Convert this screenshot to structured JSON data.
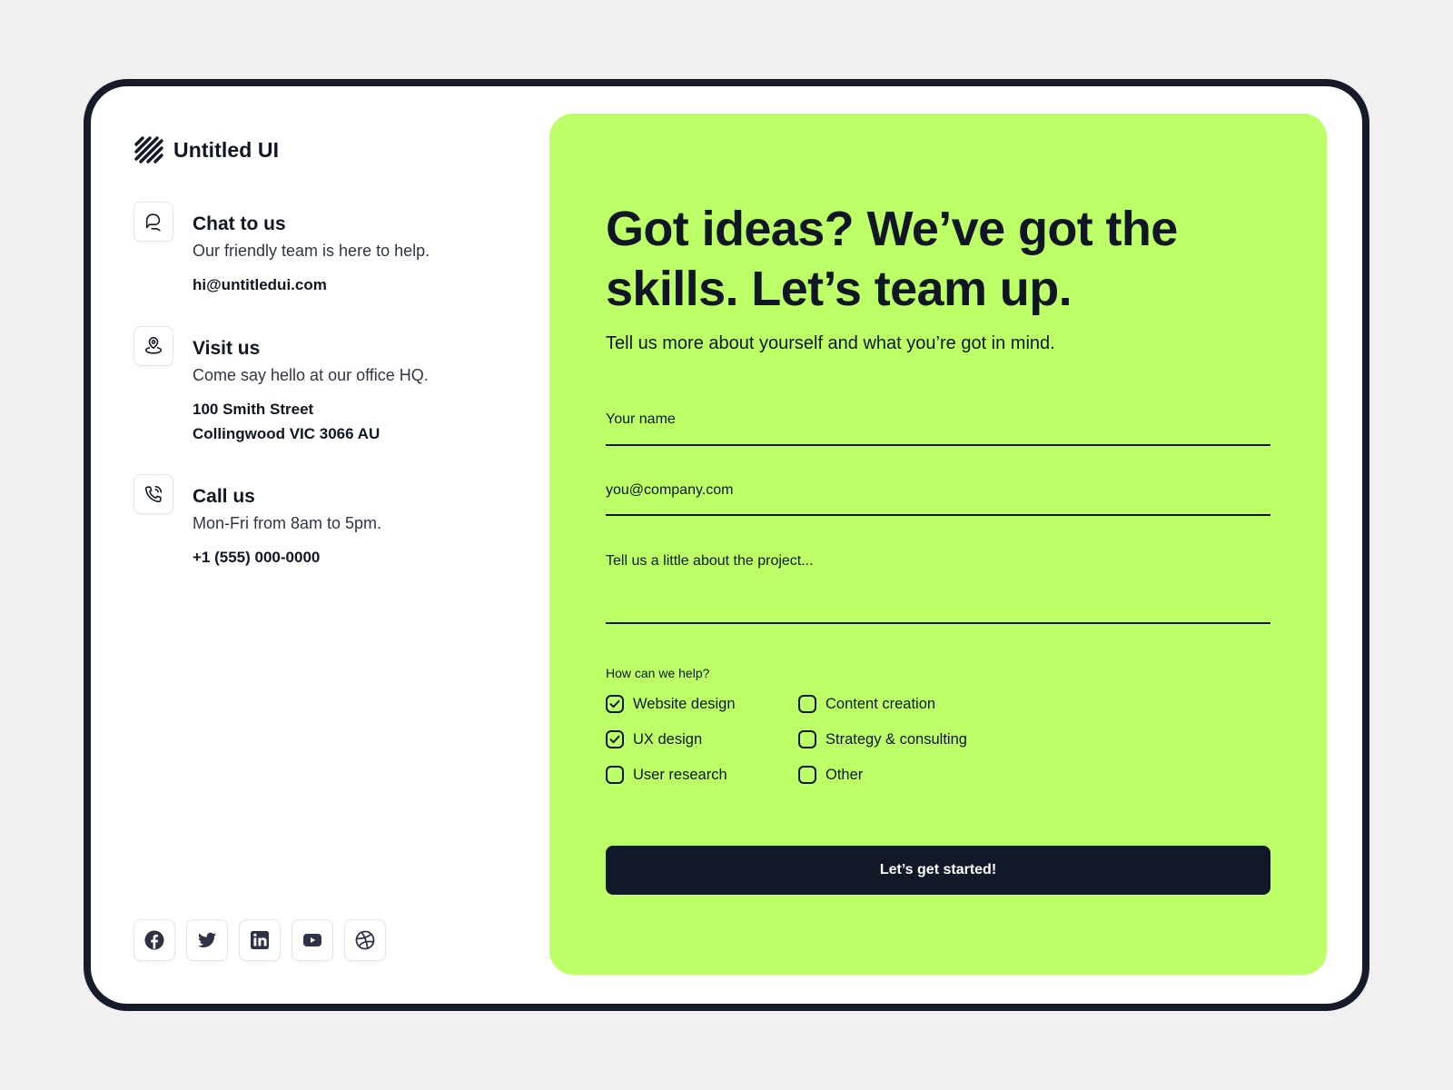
{
  "brand": {
    "name": "Untitled UI",
    "logo_icon": "untitled-ui-logo-icon"
  },
  "contacts": [
    {
      "icon": "chat-bubble-icon",
      "title": "Chat to us",
      "subtitle": "Our friendly team is here to help.",
      "value_lines": [
        "hi@untitledui.com"
      ]
    },
    {
      "icon": "map-pin-icon",
      "title": "Visit us",
      "subtitle": "Come say hello at our office HQ.",
      "value_lines": [
        "100 Smith Street",
        "Collingwood VIC 3066 AU"
      ]
    },
    {
      "icon": "phone-icon",
      "title": "Call us",
      "subtitle": "Mon-Fri from 8am to 5pm.",
      "value_lines": [
        "+1 (555) 000-0000"
      ]
    }
  ],
  "socials": [
    "facebook-icon",
    "twitter-icon",
    "linkedin-icon",
    "youtube-icon",
    "dribbble-icon"
  ],
  "form": {
    "headline": "Got ideas? We’ve got the skills. Let’s team up.",
    "subheadline": "Tell us more about yourself and what you’re got in mind.",
    "name_placeholder": "Your name",
    "email_placeholder": "you@company.com",
    "project_placeholder": "Tell us a little about the project...",
    "help_label": "How can we help?",
    "options": [
      {
        "label": "Website design",
        "checked": true
      },
      {
        "label": "Content creation",
        "checked": false
      },
      {
        "label": "UX design",
        "checked": true
      },
      {
        "label": "Strategy & consulting",
        "checked": false
      },
      {
        "label": "User research",
        "checked": false
      },
      {
        "label": "Other",
        "checked": false
      }
    ],
    "submit_label": "Let’s get started!"
  },
  "colors": {
    "accent": "#bdff66",
    "dark": "#111827",
    "frame": "#161b2a",
    "page_bg": "#f0f0f0"
  }
}
